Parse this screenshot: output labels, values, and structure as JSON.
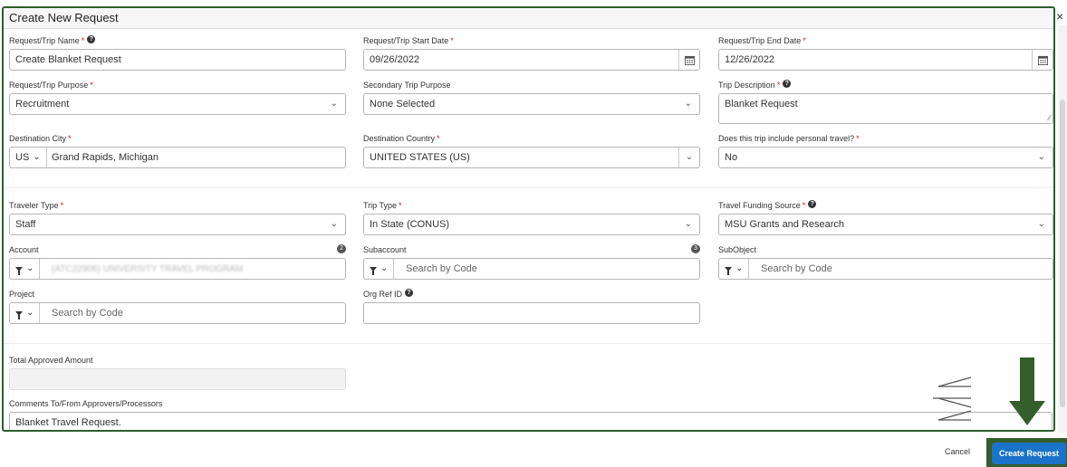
{
  "dialog": {
    "title": "Create New Request",
    "close_glyph": "×"
  },
  "fields": {
    "trip_name": {
      "label": "Request/Trip Name",
      "value": "Create Blanket Request"
    },
    "start_date": {
      "label": "Request/Trip Start Date",
      "value": "09/26/2022"
    },
    "end_date": {
      "label": "Request/Trip End Date",
      "value": "12/26/2022"
    },
    "trip_purpose": {
      "label": "Request/Trip Purpose",
      "value": "Recruitment"
    },
    "secondary_purpose": {
      "label": "Secondary Trip Purpose",
      "value": "None Selected"
    },
    "trip_description": {
      "label": "Trip Description",
      "value": "Blanket Request"
    },
    "destination_city": {
      "label": "Destination City",
      "country_code": "US",
      "value": "Grand Rapids, Michigan"
    },
    "destination_country": {
      "label": "Destination Country",
      "value": "UNITED STATES (US)"
    },
    "personal_travel": {
      "label": "Does this trip include personal travel?",
      "value": "No"
    },
    "traveler_type": {
      "label": "Traveler Type",
      "value": "Staff"
    },
    "trip_type": {
      "label": "Trip Type",
      "value": "In State (CONUS)"
    },
    "funding_source": {
      "label": "Travel Funding Source",
      "value": "MSU Grants and Research"
    },
    "account": {
      "label": "Account",
      "badge": "2",
      "value": "(ATC22906) UNIVERSITY TRAVEL PROGRAM"
    },
    "subaccount": {
      "label": "Subaccount",
      "badge": "3",
      "placeholder": "Search by Code"
    },
    "subobject": {
      "label": "SubObject",
      "placeholder": "Search by Code"
    },
    "project": {
      "label": "Project",
      "placeholder": "Search by Code"
    },
    "org_ref_id": {
      "label": "Org Ref ID",
      "value": ""
    },
    "total_approved": {
      "label": "Total Approved Amount",
      "value": ""
    },
    "comments": {
      "label": "Comments To/From Approvers/Processors",
      "value": "Blanket Travel Request."
    }
  },
  "footer": {
    "cancel_label": "Cancel",
    "create_label": "Create Request"
  },
  "colors": {
    "highlight_green": "#355e2d",
    "primary_blue": "#1a73c8",
    "required_red": "#d11111"
  }
}
